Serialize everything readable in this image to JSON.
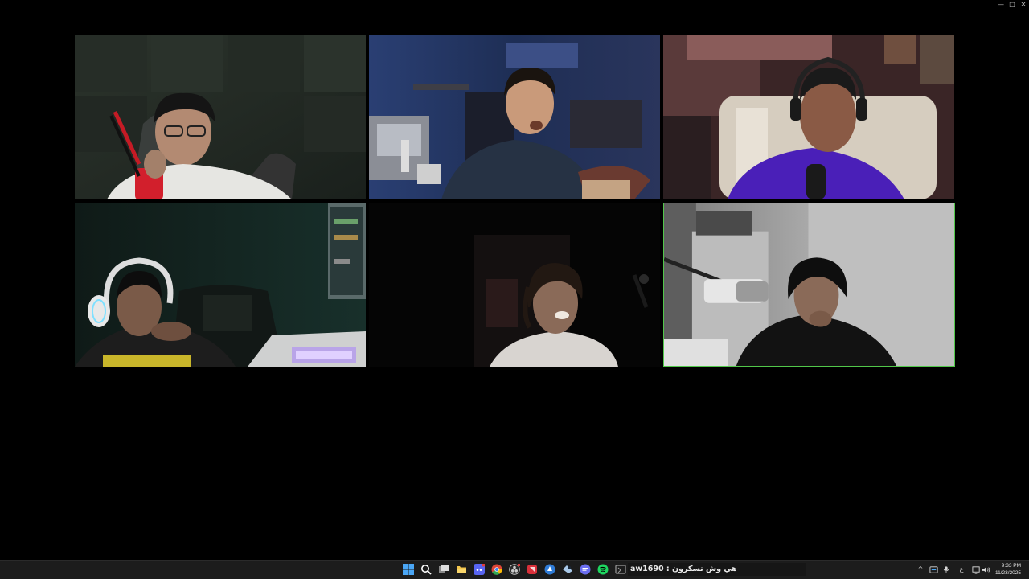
{
  "window": {
    "controls": {
      "minimize": "—",
      "maximize": "□",
      "close": "✕"
    }
  },
  "participants": [
    {
      "id": "p1",
      "description": "man with glasses and headset at desk with microphone",
      "active": false
    },
    {
      "id": "p2",
      "description": "man talking in blue-lit room",
      "active": false
    },
    {
      "id": "p3",
      "description": "man with purple hoodie and headset",
      "active": false
    },
    {
      "id": "p4",
      "description": "man with white headset in dark green room",
      "active": false
    },
    {
      "id": "p5",
      "description": "smiling man in dark room",
      "active": false
    },
    {
      "id": "p6",
      "description": "man in black hoodie with microphone, speaking",
      "active": true
    }
  ],
  "taskbar": {
    "icons": [
      {
        "name": "windows-start-icon",
        "color": "#3b9cf0"
      },
      {
        "name": "search-icon",
        "color": "#ffffff"
      },
      {
        "name": "task-view-icon",
        "color": "#dddddd"
      },
      {
        "name": "file-explorer-icon",
        "color": "#f3c64d"
      },
      {
        "name": "discord-icon",
        "color": "#5865f2"
      },
      {
        "name": "chrome-icon",
        "color": "#34a853"
      },
      {
        "name": "obs-icon",
        "color": "#cccccc"
      },
      {
        "name": "red-app-icon",
        "color": "#d9303a"
      },
      {
        "name": "blue-app-icon",
        "color": "#2f7bd6"
      },
      {
        "name": "steam-icon",
        "color": "#a9c8e8"
      },
      {
        "name": "chat-app-icon",
        "color": "#6b6ef0"
      },
      {
        "name": "spotify-icon",
        "color": "#1ed760"
      },
      {
        "name": "terminal-icon",
        "color": "#9a9a9a"
      }
    ],
    "now_playing": "aw1690 : هي وش تسكرون",
    "tray": {
      "chevron": "^",
      "language": "ع",
      "clock_time": "9:33 PM",
      "clock_date": "11/23/2025"
    }
  }
}
